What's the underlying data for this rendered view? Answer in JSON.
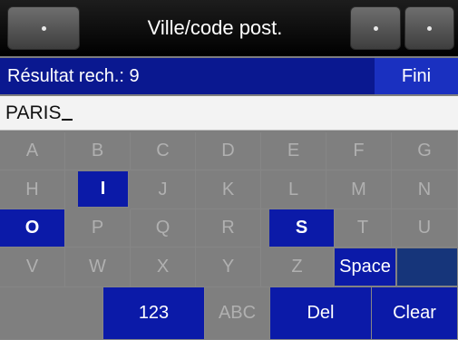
{
  "header": {
    "title": "Ville/code post.",
    "left_button_icon": "dot-icon",
    "right_buttons_icons": [
      "dot-icon",
      "dot-icon"
    ]
  },
  "results": {
    "label": "Résultat rech.: 9",
    "done_label": "Fini"
  },
  "search": {
    "value": "PARIS"
  },
  "keyboard": {
    "rows": [
      [
        "A",
        "B",
        "C",
        "D",
        "E",
        "F",
        "G"
      ],
      [
        "H",
        "I",
        "J",
        "K",
        "L",
        "M",
        "N"
      ],
      [
        "O",
        "P",
        "Q",
        "R",
        "S",
        "T",
        "U"
      ],
      [
        "V",
        "W",
        "X",
        "Y",
        "Z"
      ]
    ],
    "space_label": "Space",
    "num_label": "123",
    "abc_label": "ABC",
    "del_label": "Del",
    "clear_label": "Clear"
  },
  "colors": {
    "active_key": "#0b1aa8",
    "result_bar": "#0a1890",
    "inactive_key_text": "#a9a9a9"
  }
}
